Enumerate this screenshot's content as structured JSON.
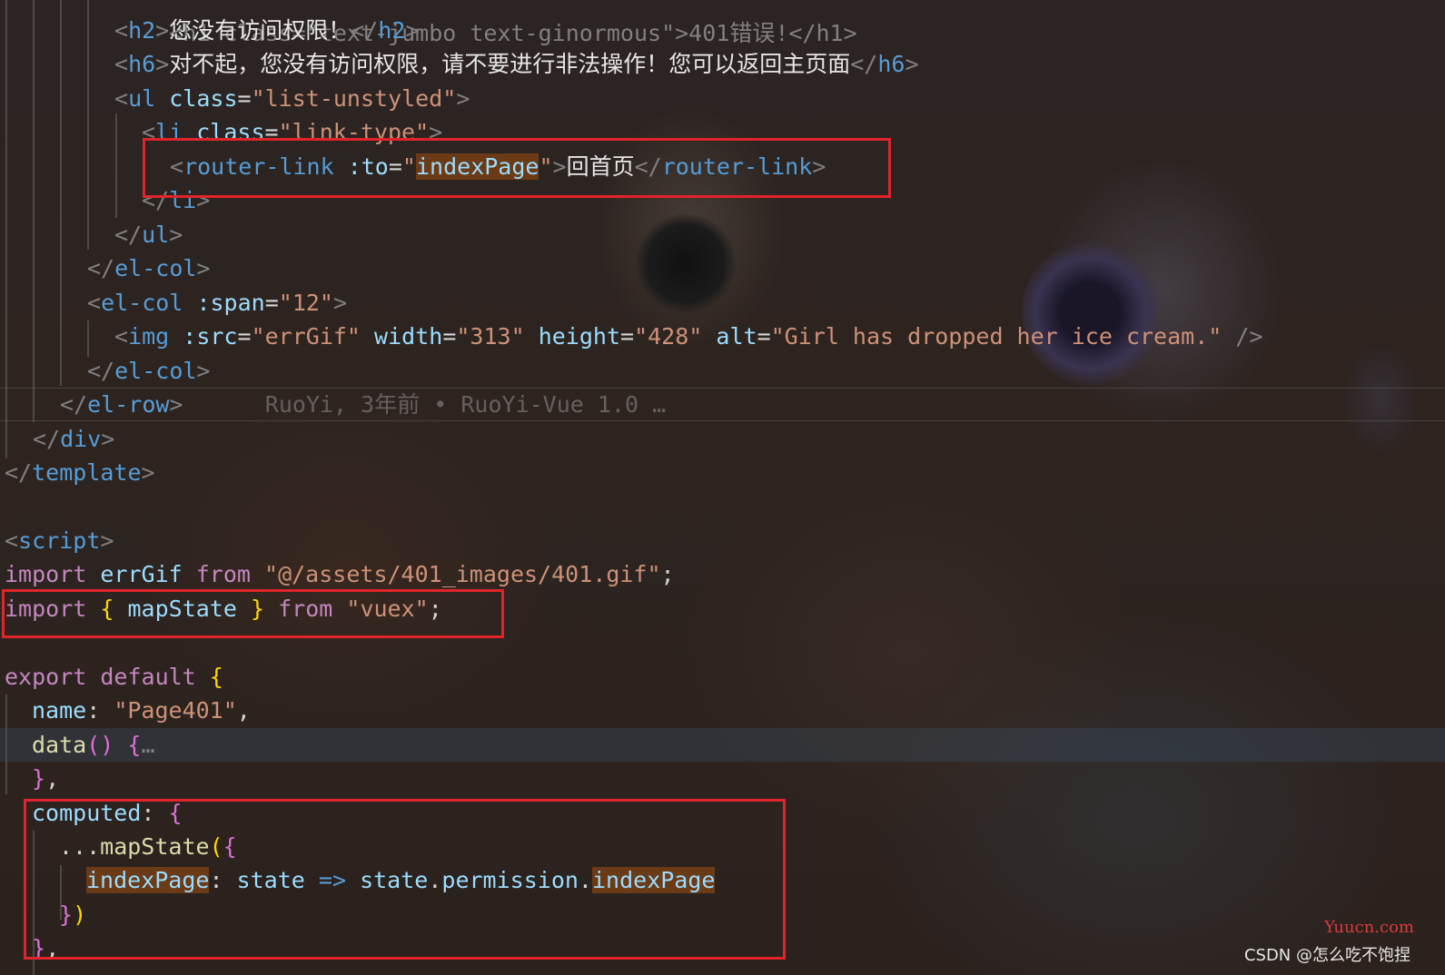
{
  "code": {
    "l1_open": "<h1 class=\"text-jumbo text-ginormous\">401错误!</h1>",
    "l2_open": "<",
    "l2_tag": "h2",
    "l2_text": "您没有访问权限！",
    "l2_close_tag": "h2",
    "l3_tag": "h6",
    "l3_text": "对不起，您没有访问权限，请不要进行非法操作！您可以返回主页面",
    "l3_close_tag": "h6",
    "l4_tag": "ul",
    "l4_attr": "class",
    "l4_val": "\"list-unstyled\"",
    "l5_tag": "li",
    "l5_attr": "class",
    "l5_val": "\"link-type\"",
    "l6_tag": "router-link",
    "l6_attr": ":to",
    "l6_val_q1": "\"",
    "l6_val": "indexPage",
    "l6_val_q2": "\"",
    "l6_text": "回首页",
    "l6_close_tag": "router-link",
    "l7_tag": "li",
    "l8_tag": "ul",
    "l9_tag": "el-col",
    "l10_tag": "el-col",
    "l10_attr": ":span",
    "l10_val": "\"12\"",
    "l11_tag": "img",
    "l11_a1": ":src",
    "l11_v1": "\"errGif\"",
    "l11_a2": "width",
    "l11_v2": "\"313\"",
    "l11_a3": "height",
    "l11_v3": "\"428\"",
    "l11_a4": "alt",
    "l11_v4": "\"Girl has dropped her ice cream.\"",
    "l12_tag": "el-col",
    "l13_tag": "el-row",
    "l13_blame": "RuoYi, 3年前 • RuoYi-Vue 1.0 …",
    "l14_tag": "div",
    "l15_tag": "template",
    "l17_tag": "script",
    "l18_kw1": "import",
    "l18_id": "errGif",
    "l18_kw2": "from",
    "l18_str": "\"@/assets/401_images/401.gif\"",
    "l19_kw1": "import",
    "l19_id": "mapState",
    "l19_kw2": "from",
    "l19_str": "\"vuex\"",
    "l21_kw1": "export",
    "l21_kw2": "default",
    "l22_key": "name",
    "l22_str": "\"Page401\"",
    "l23_fn": "data",
    "l23_fold": "…",
    "l25_key": "computed",
    "l26_spread": "...",
    "l26_fn": "mapState",
    "l27_key": "indexPage",
    "l27_param": "state",
    "l27_arrow": "=>",
    "l27_obj": "state",
    "l27_prop": "permission",
    "l27_prop2": "indexPage"
  },
  "watermark": {
    "site": "Yuucn.com",
    "author": "CSDN @怎么吃不饱捏"
  },
  "colors": {
    "highlight_box": "#e0242a",
    "selection": "#6b3a16"
  }
}
